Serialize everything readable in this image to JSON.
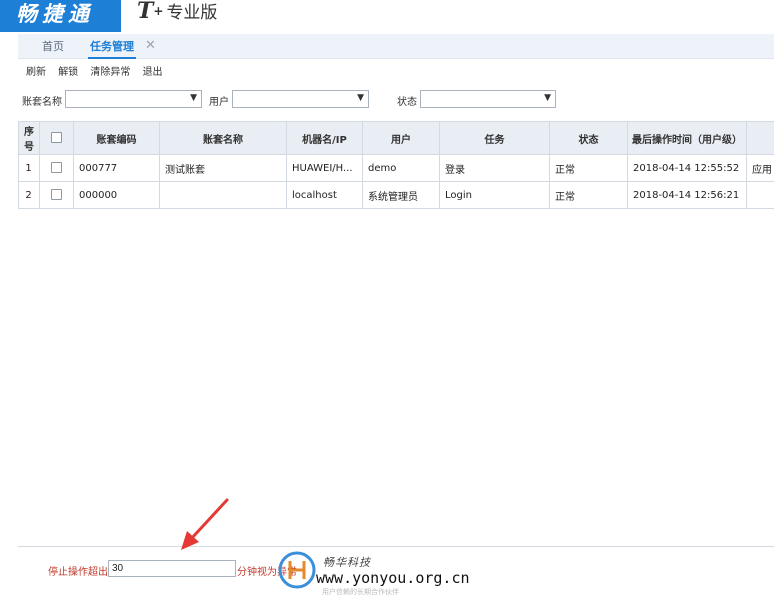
{
  "header": {
    "brand": "畅捷通",
    "edition_t": "T",
    "edition_plus": "+",
    "edition_name": "专业版"
  },
  "tabs": [
    {
      "label": "首页"
    },
    {
      "label": "任务管理"
    }
  ],
  "toolbar": [
    "刷新",
    "解锁",
    "清除异常",
    "退出"
  ],
  "filters": {
    "account_label": "账套名称",
    "user_label": "用户",
    "status_label": "状态"
  },
  "table": {
    "headers": [
      "序号",
      "",
      "账套编码",
      "账套名称",
      "机器名/IP",
      "用户",
      "任务",
      "状态",
      "最后操作时间（用户级）",
      ""
    ],
    "rows": [
      {
        "no": "1",
        "code": "000777",
        "name": "测试账套",
        "machine": "HUAWEI/H...",
        "user": "demo",
        "task": "登录",
        "status": "正常",
        "time": "2018-04-14 12:55:52",
        "extra": "应用"
      },
      {
        "no": "2",
        "code": "000000",
        "name": "",
        "machine": "localhost",
        "user": "系统管理员",
        "task": "Login",
        "status": "正常",
        "time": "2018-04-14 12:56:21",
        "extra": ""
      }
    ]
  },
  "footer": {
    "prefix": "停止操作超出",
    "minutes": "30",
    "suffix": "分钟视为异常"
  },
  "watermark": {
    "cn": "畅华科技",
    "url": "www.yonyou.org.cn",
    "sub": "用户信赖的长期合作伙伴"
  },
  "colors": {
    "brand_blue": "#1d7fd6",
    "warning_red": "#c0392b",
    "arrow_red": "#e53935"
  }
}
